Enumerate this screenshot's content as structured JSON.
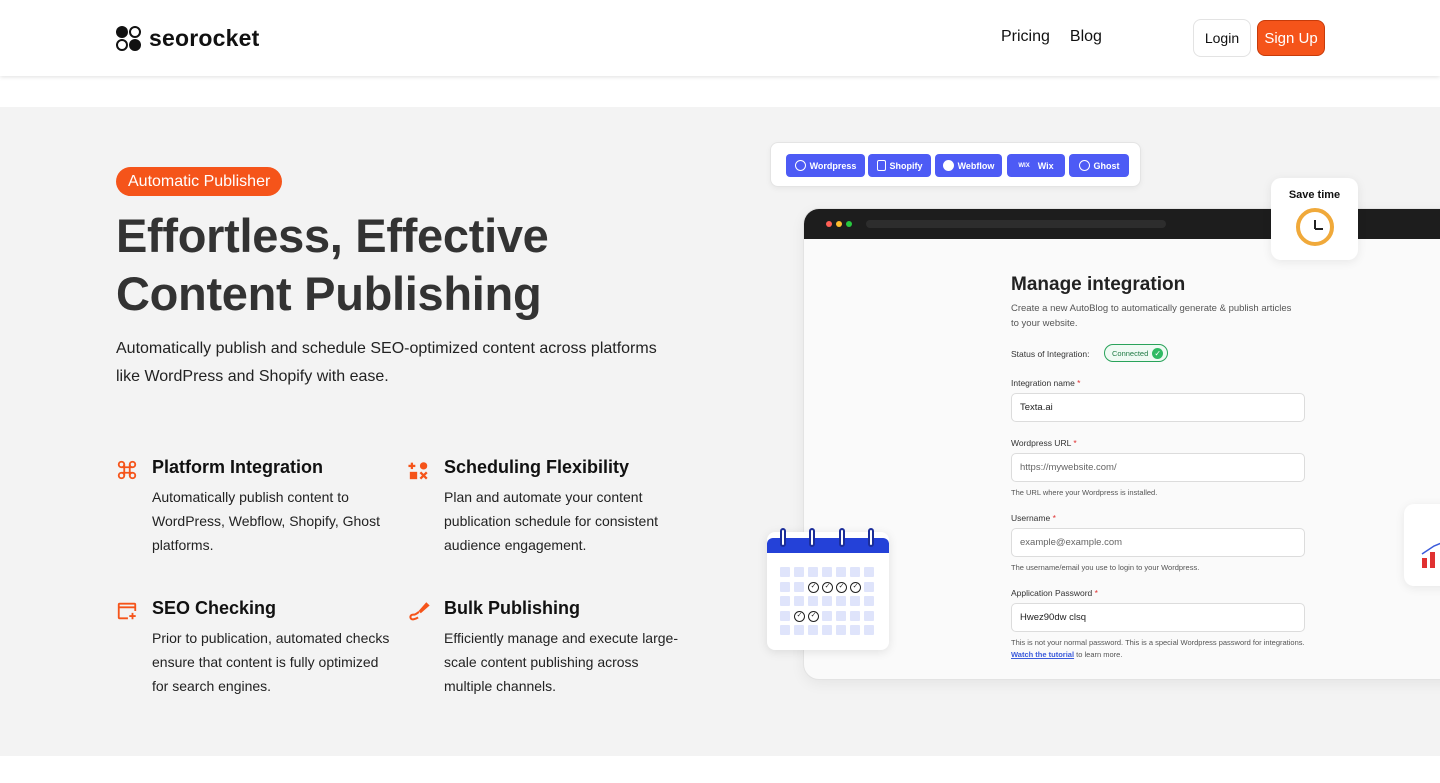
{
  "header": {
    "brand": "seorocket",
    "nav": [
      {
        "label": "Pricing"
      },
      {
        "label": "Blog"
      }
    ],
    "login_label": "Login",
    "signup_label": "Sign Up"
  },
  "hero": {
    "badge": "Automatic Publisher",
    "title_line1": "Effortless, Effective",
    "title_line2": "Content Publishing",
    "lead": "Automatically publish and schedule SEO-optimized content across platforms like WordPress and Shopify with ease.",
    "features": [
      {
        "icon": "command-icon",
        "title": "Platform Integration",
        "desc": "Automatically publish content to WordPress, Webflow, Shopify, Ghost platforms."
      },
      {
        "icon": "scheduling-icon",
        "title": "Scheduling Flexibility",
        "desc": "Plan and automate your content publication schedule for consistent audience engagement."
      },
      {
        "icon": "seo-check-icon",
        "title": "SEO Checking",
        "desc": "Prior to publication, automated checks ensure that content is fully optimized for search engines."
      },
      {
        "icon": "bulk-publish-icon",
        "title": "Bulk Publishing",
        "desc": "Efficiently manage and execute large-scale content publishing across multiple channels."
      }
    ]
  },
  "platforms": [
    {
      "label": "Wordpress",
      "icon": "wordpress-icon"
    },
    {
      "label": "Shopify",
      "icon": "shopify-icon"
    },
    {
      "label": "Webflow",
      "icon": "webflow-icon"
    },
    {
      "label": "Wix",
      "icon": "wix-icon",
      "prefix": "WIX"
    },
    {
      "label": "Ghost",
      "icon": "ghost-icon"
    }
  ],
  "save_time": {
    "label": "Save time"
  },
  "integration": {
    "title": "Manage integration",
    "subtitle": "Create a new AutoBlog to automatically generate & publish articles to your website.",
    "status_label": "Status of Integration:",
    "status_value": "Connected",
    "fields": [
      {
        "label": "Integration name",
        "value": "Texta.ai",
        "placeholder": "",
        "help": ""
      },
      {
        "label": "Wordpress URL",
        "value": "",
        "placeholder": "https://mywebsite.com/",
        "help": "The URL where your Wordpress is installed."
      },
      {
        "label": "Username",
        "value": "",
        "placeholder": "example@example.com",
        "help": "The username/email you use to login to your Wordpress."
      },
      {
        "label": "Application Password",
        "value": "Hwez90dw clsq",
        "placeholder": "",
        "help": ""
      }
    ],
    "password_help_pre": "This is not your normal password. This is a special Wordpress password for integrations.",
    "password_help_link": "Watch the tutorial",
    "password_help_post": "to learn more.",
    "required_mark": "*"
  },
  "colors": {
    "accent": "#f5541a",
    "platform_blue": "#4d5bf5",
    "hero_bg": "#f3f3f3",
    "connected_green": "#2fba63",
    "clock_orange": "#f0a93a",
    "calendar_blue": "#2441d8"
  }
}
